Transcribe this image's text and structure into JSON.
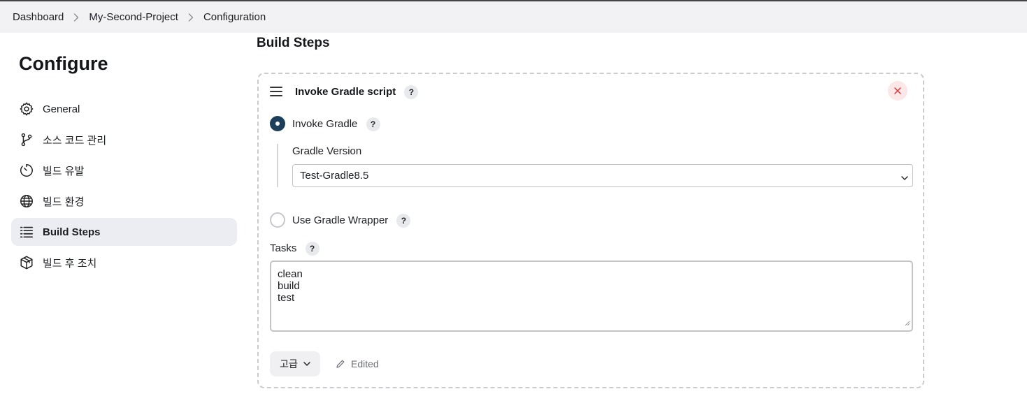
{
  "breadcrumb": {
    "items": [
      "Dashboard",
      "My-Second-Project",
      "Configuration"
    ]
  },
  "sidebar": {
    "title": "Configure",
    "items": [
      {
        "label": "General",
        "icon": "gear-icon",
        "active": false
      },
      {
        "label": "소스 코드 관리",
        "icon": "git-branch-icon",
        "active": false
      },
      {
        "label": "빌드 유발",
        "icon": "timer-icon",
        "active": false
      },
      {
        "label": "빌드 환경",
        "icon": "globe-icon",
        "active": false
      },
      {
        "label": "Build Steps",
        "icon": "list-icon",
        "active": true
      },
      {
        "label": "빌드 후 조치",
        "icon": "package-icon",
        "active": false
      }
    ]
  },
  "main": {
    "section_title": "Build Steps",
    "step": {
      "title": "Invoke Gradle script",
      "help_label": "?",
      "options": [
        {
          "label": "Invoke Gradle",
          "selected": true
        },
        {
          "label": "Use Gradle Wrapper",
          "selected": false
        }
      ],
      "gradle_version_label": "Gradle Version",
      "gradle_version_value": "Test-Gradle8.5",
      "tasks_label": "Tasks",
      "tasks_lines": [
        "clean",
        "build",
        "test"
      ],
      "advanced_label": "고급",
      "edited_label": "Edited"
    }
  },
  "colors": {
    "radio_selected": "#1e3f5a",
    "active_nav_bg": "#ececf3",
    "close_bg": "#fbe7e7",
    "close_x": "#d33a3a"
  }
}
